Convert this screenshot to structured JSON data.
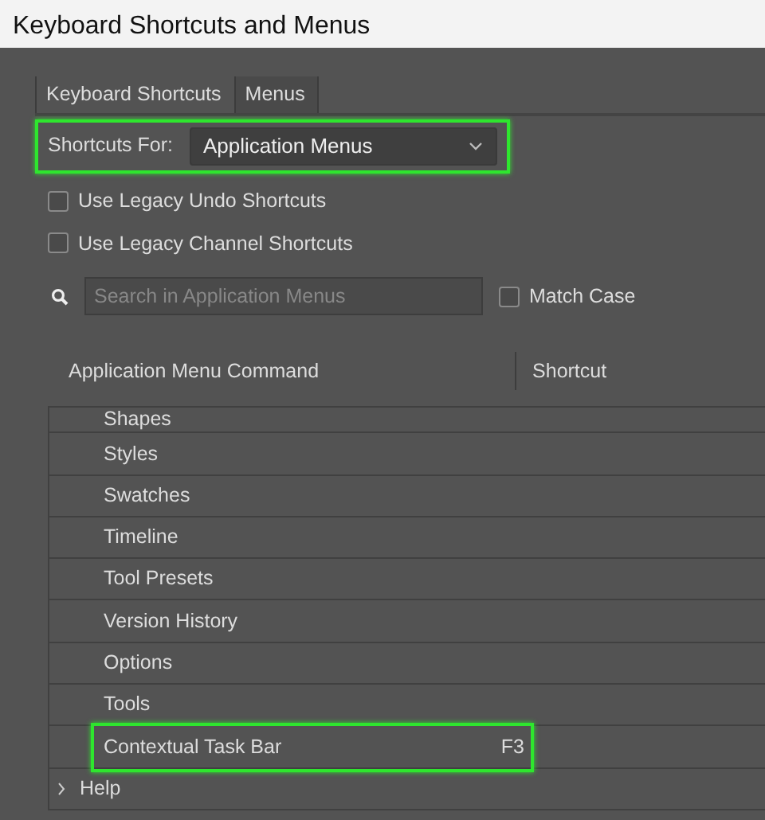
{
  "window": {
    "title": "Keyboard Shortcuts and Menus"
  },
  "tabs": [
    {
      "label": "Keyboard Shortcuts",
      "selected": true
    },
    {
      "label": "Menus",
      "selected": false
    }
  ],
  "shortcuts_for": {
    "label": "Shortcuts For:",
    "value": "Application Menus",
    "highlighted": true
  },
  "options": [
    {
      "label": "Use Legacy Undo Shortcuts",
      "checked": false
    },
    {
      "label": "Use Legacy Channel Shortcuts",
      "checked": false
    }
  ],
  "search": {
    "placeholder": "Search in Application Menus"
  },
  "match_case": {
    "label": "Match Case",
    "checked": false
  },
  "table": {
    "columns": [
      "Application Menu Command",
      "Shortcut"
    ],
    "rows": [
      {
        "kind": "item",
        "command": "Shapes",
        "highlighted": false
      },
      {
        "kind": "item",
        "command": "Styles",
        "highlighted": false
      },
      {
        "kind": "item",
        "command": "Swatches",
        "highlighted": false
      },
      {
        "kind": "item",
        "command": "Timeline",
        "highlighted": false
      },
      {
        "kind": "item",
        "command": "Tool Presets",
        "highlighted": false
      },
      {
        "kind": "item",
        "command": "Version History",
        "highlighted": false
      },
      {
        "kind": "item",
        "command": "Options",
        "highlighted": false
      },
      {
        "kind": "item",
        "command": "Tools",
        "highlighted": false
      },
      {
        "kind": "item",
        "command": "Contextual Task Bar",
        "shortcut": "F3",
        "highlighted": true
      },
      {
        "kind": "group",
        "command": "Help",
        "expanded": false
      }
    ]
  }
}
